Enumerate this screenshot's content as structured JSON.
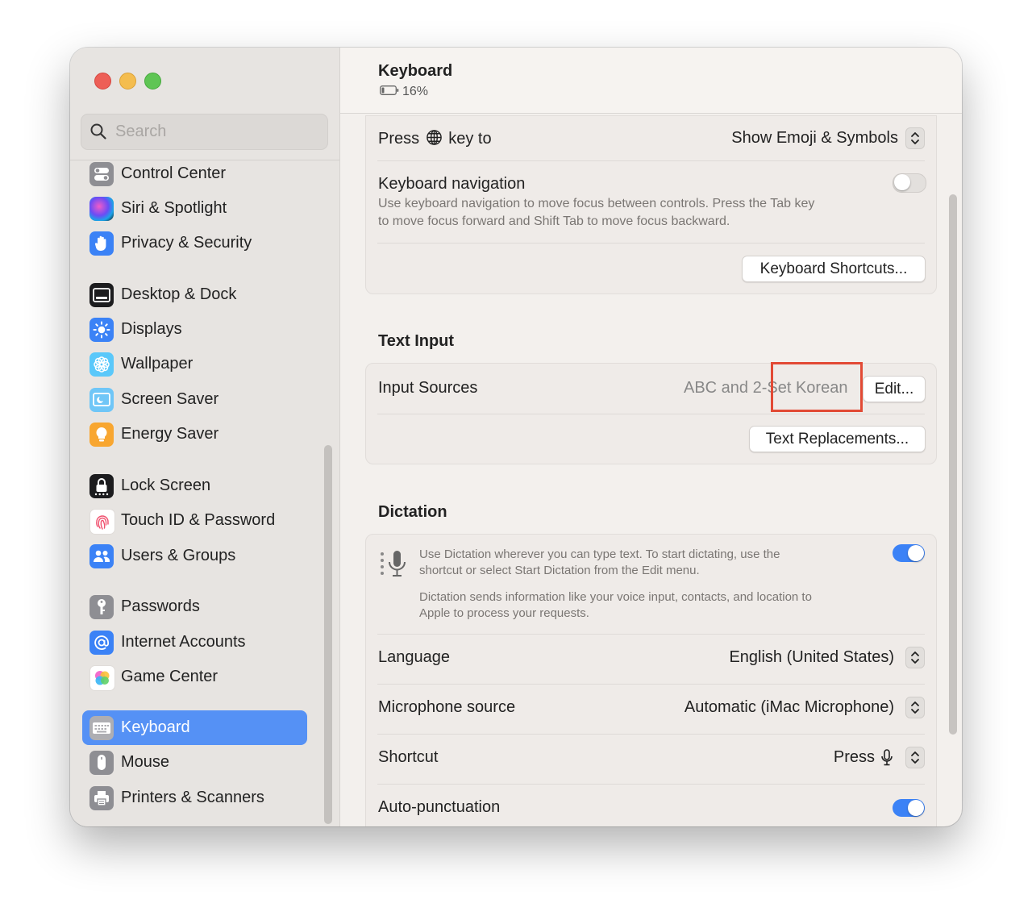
{
  "window": {
    "title": "Keyboard",
    "battery": "16%"
  },
  "sidebar": {
    "search_placeholder": "Search",
    "items": [
      {
        "label": "Control Center",
        "icon": "control-center-icon"
      },
      {
        "label": "Siri & Spotlight",
        "icon": "siri-icon"
      },
      {
        "label": "Privacy & Security",
        "icon": "hand-icon"
      },
      {
        "label": "Desktop & Dock",
        "icon": "dock-icon"
      },
      {
        "label": "Displays",
        "icon": "sun-icon"
      },
      {
        "label": "Wallpaper",
        "icon": "flower-icon"
      },
      {
        "label": "Screen Saver",
        "icon": "screen-saver-icon"
      },
      {
        "label": "Energy Saver",
        "icon": "bulb-icon"
      },
      {
        "label": "Lock Screen",
        "icon": "lock-icon"
      },
      {
        "label": "Touch ID & Password",
        "icon": "fingerprint-icon"
      },
      {
        "label": "Users & Groups",
        "icon": "users-icon"
      },
      {
        "label": "Passwords",
        "icon": "key-icon"
      },
      {
        "label": "Internet Accounts",
        "icon": "at-icon"
      },
      {
        "label": "Game Center",
        "icon": "game-center-icon"
      },
      {
        "label": "Keyboard",
        "icon": "keyboard-icon"
      },
      {
        "label": "Mouse",
        "icon": "mouse-icon"
      },
      {
        "label": "Printers & Scanners",
        "icon": "printer-icon"
      }
    ]
  },
  "keyboard": {
    "press_key_prefix": "Press",
    "press_key_suffix": "key to",
    "press_key_value": "Show Emoji & Symbols",
    "nav_title": "Keyboard navigation",
    "nav_desc_line1": "Use keyboard navigation to move focus between controls. Press the Tab key",
    "nav_desc_line2": "to move focus forward and Shift Tab to move focus backward.",
    "nav_enabled": false,
    "shortcuts_button": "Keyboard Shortcuts..."
  },
  "text_input": {
    "heading": "Text Input",
    "sources_label": "Input Sources",
    "sources_value": "ABC and 2-Set Korean",
    "edit_button": "Edit...",
    "replacements_button": "Text Replacements..."
  },
  "dictation": {
    "heading": "Dictation",
    "desc_line1": "Use Dictation wherever you can type text. To start dictating, use the",
    "desc_line2": "shortcut or select Start Dictation from the Edit menu.",
    "privacy_line1": "Dictation sends information like your voice input, contacts, and location to",
    "privacy_line2": "Apple to process your requests.",
    "enabled": true,
    "language_label": "Language",
    "language_value": "English (United States)",
    "mic_label": "Microphone source",
    "mic_value": "Automatic (iMac Microphone)",
    "shortcut_label": "Shortcut",
    "shortcut_value": "Press",
    "autopunct_label": "Auto-punctuation",
    "autopunct_enabled": true
  },
  "colors": {
    "accent": "#3b82f6",
    "sidebar_selected": "#5591f5",
    "highlight": "#e24a35"
  }
}
